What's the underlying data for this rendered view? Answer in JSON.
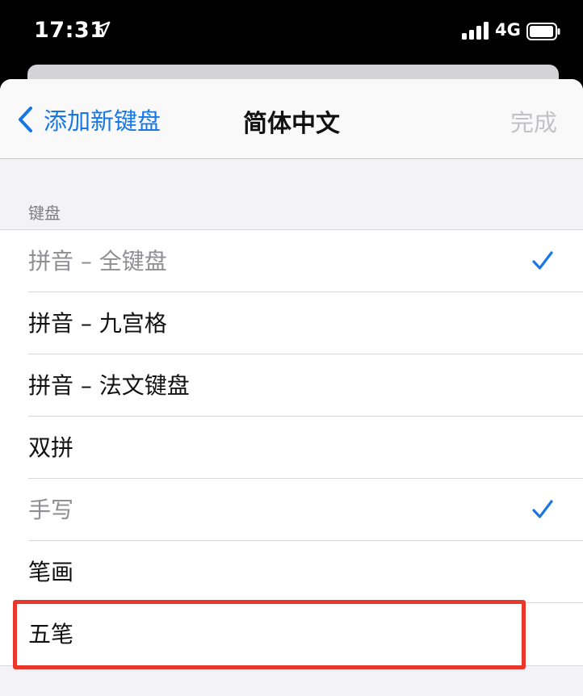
{
  "status_bar": {
    "time": "17:31",
    "network": "4G",
    "icons": [
      "location-arrow-icon",
      "signal-bars-icon",
      "battery-icon"
    ]
  },
  "nav": {
    "back_label": "添加新键盘",
    "title": "简体中文",
    "done_label": "完成"
  },
  "section": {
    "header": "键盘"
  },
  "keyboards": [
    {
      "label": "拼音 – 全键盘",
      "checked": true,
      "disabled": true
    },
    {
      "label": "拼音 – 九宫格",
      "checked": false,
      "disabled": false
    },
    {
      "label": "拼音 – 法文键盘",
      "checked": false,
      "disabled": false
    },
    {
      "label": "双拼",
      "checked": false,
      "disabled": false
    },
    {
      "label": "手写",
      "checked": true,
      "disabled": true
    },
    {
      "label": "笔画",
      "checked": false,
      "disabled": false
    },
    {
      "label": "五笔",
      "checked": false,
      "disabled": false
    }
  ],
  "colors": {
    "accent": "#1877e5",
    "highlight_box": "#e8372b",
    "disabled_text": "#8e8e93"
  }
}
